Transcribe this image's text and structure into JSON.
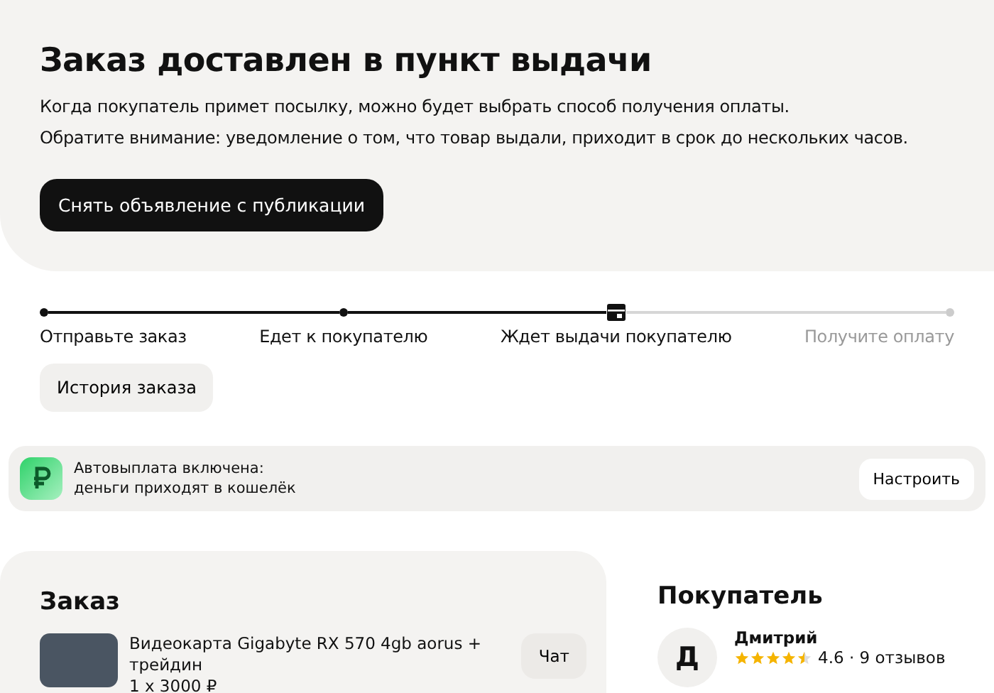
{
  "header": {
    "title": "Заказ доставлен в пункт выдачи",
    "notes": [
      "Когда покупатель примет посылку, можно будет выбрать способ получения оплаты.",
      "Обратите внимание: уведомление о том, что товар выдали, приходит в срок до нескольких часов."
    ],
    "action": "Снять объявление с публикации"
  },
  "steps": [
    {
      "label": "Отправьте заказ",
      "reached": true,
      "current": false
    },
    {
      "label": "Едет к покупателю",
      "reached": true,
      "current": false
    },
    {
      "label": "Ждет выдачи покупателю",
      "reached": true,
      "current": true
    },
    {
      "label": "Получите оплату",
      "reached": false,
      "current": false
    }
  ],
  "history_button": "История заказа",
  "payout_banner": {
    "line_1": "Автовыплата включена:",
    "line_2": "деньги приходят в кошелёк",
    "button": "Настроить"
  },
  "order": {
    "title": "Заказ",
    "item": {
      "name": "Видеокарта Gigabyte RX 570 4gb aorus + трейдин",
      "price": "1 x 3000 ₽"
    },
    "chat_button": "Чат"
  },
  "buyer": {
    "title": "Покупатель",
    "initial": "Д",
    "name": "Дмитрий",
    "stars": 4.5,
    "rating": "4.6 · 9 отзывов"
  }
}
